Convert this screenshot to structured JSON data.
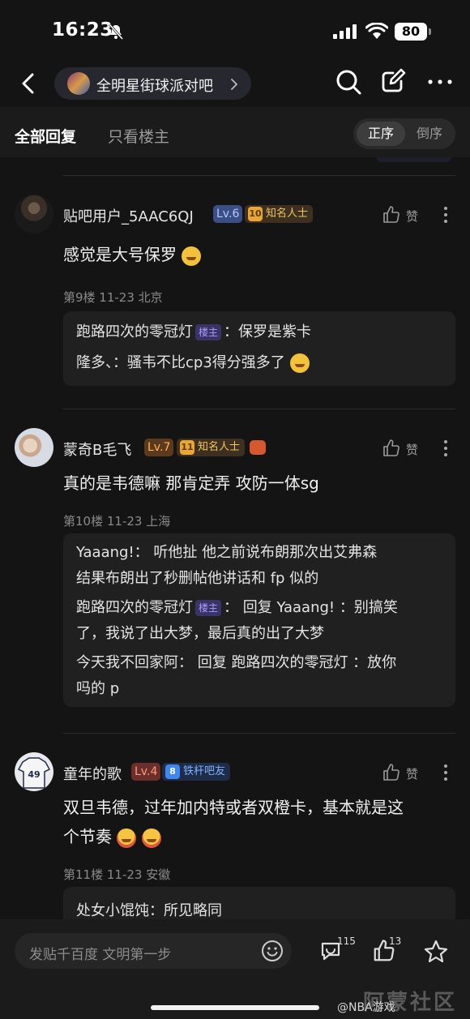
{
  "status_bar": {
    "time": "16:23",
    "battery": "80"
  },
  "nav": {
    "forum_name": "全明星街球派对吧"
  },
  "tabs": {
    "all": "全部回复",
    "op_only": "只看楼主",
    "sort_asc": "正序",
    "sort_desc": "倒序"
  },
  "posts": [
    {
      "username": "贴吧用户_5AAC6QJ",
      "level": "Lv.6",
      "badge_num": "10",
      "badge_label": "知名人士",
      "like_label": "赞",
      "text": "感觉是大号保罗",
      "meta": "第9楼   11-23   北京",
      "replies": [
        {
          "author": "跑路四次的零冠灯",
          "owner_tag": "楼主",
          "text": "：保罗是紫卡"
        },
        {
          "author": "隆多、",
          "text": "：骚韦不比cp3得分强多了"
        }
      ]
    },
    {
      "username": "蒙奇Β毛飞",
      "level": "Lv.7",
      "badge_num": "11",
      "badge_label": "知名人士",
      "like_label": "赞",
      "text": "真的是韦德嘛 那肯定弄 攻防一体sg",
      "meta": "第10楼   11-23   上海",
      "replies": [
        {
          "author": "Yaaang!",
          "text": "： 听他扯 他之前说布朗那次出艾弗森",
          "text2": "结果布朗出了秒删帖他讲话和 fp 似的"
        },
        {
          "author": "跑路四次的零冠灯",
          "owner_tag": "楼主",
          "text": "： 回复 Yaaang! ：别搞笑",
          "text2": "了，我说了出大梦，最后真的出了大梦"
        },
        {
          "author": "今天我不回家阿",
          "text": "： 回复 跑路四次的零冠灯 ：放你",
          "text2": "吗的 p"
        }
      ]
    },
    {
      "username": "童年的歌",
      "level": "Lv.4",
      "badge_num": "8",
      "badge_label": "铁杆吧友",
      "like_label": "赞",
      "text": "双旦韦德，过年加内特或者双橙卡，基本就是这",
      "text2": "个节奏",
      "meta": "第11楼   11-23   安徽",
      "replies": [
        {
          "author": "处女小馄饨",
          "text": "：所见略同"
        }
      ]
    }
  ],
  "bottom_bar": {
    "placeholder": "发贴千百度 文明第一步",
    "comment_count": "115",
    "like_count": "13",
    "watermark_handle": "@NBA游戏",
    "watermark_site": "阿蒙社区"
  },
  "colors": {
    "background": "#141414",
    "owner_tag": "#a99cff",
    "gold_badge": "#f1c55a",
    "blue_badge": "#7fb2ff"
  }
}
